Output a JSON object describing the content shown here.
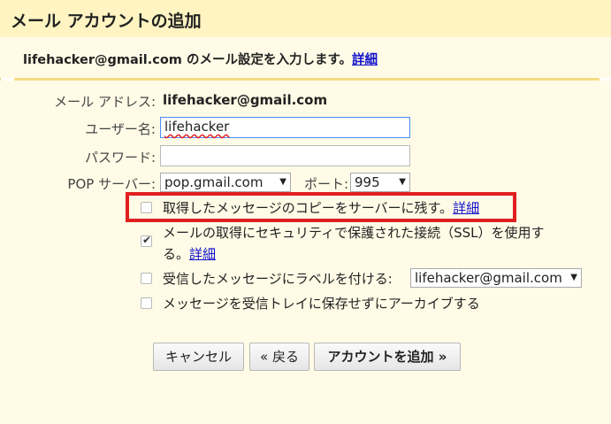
{
  "header": {
    "title": "メール アカウントの追加"
  },
  "subtitle": {
    "text": "lifehacker@gmail.com のメール設定を入力します。",
    "link": "詳細"
  },
  "form": {
    "email_label": "メール アドレス:",
    "email_value": "lifehacker@gmail.com",
    "username_label": "ユーザー名:",
    "username_value": "lifehacker",
    "password_label": "パスワード:",
    "password_value": "",
    "pop_label": "POP サーバー:",
    "pop_value": "pop.gmail.com",
    "port_label": "ポート:",
    "port_value": "995"
  },
  "options": {
    "leave_copy": {
      "label": "取得したメッセージのコピーをサーバーに残す。",
      "link": "詳細",
      "checked": false
    },
    "ssl": {
      "label_line1": "メールの取得にセキュリティで保護された接続（SSL）を使用す",
      "label_line2": "る。",
      "link": "詳細",
      "checked": true
    },
    "label_incoming": {
      "label": "受信したメッセージにラベルを付ける:",
      "select_value": "lifehacker@gmail.com",
      "checked": false
    },
    "archive": {
      "label": "メッセージを受信トレイに保存せずにアーカイブする",
      "checked": false
    }
  },
  "buttons": {
    "cancel": "キャンセル",
    "back": "« 戻る",
    "add": "アカウントを追加 »"
  },
  "colors": {
    "header_bg": "#fff4c2",
    "panel_bg": "#fffbe6",
    "separator": "#f6dd83",
    "highlight_border": "#e02020",
    "link": "#1111cc"
  }
}
